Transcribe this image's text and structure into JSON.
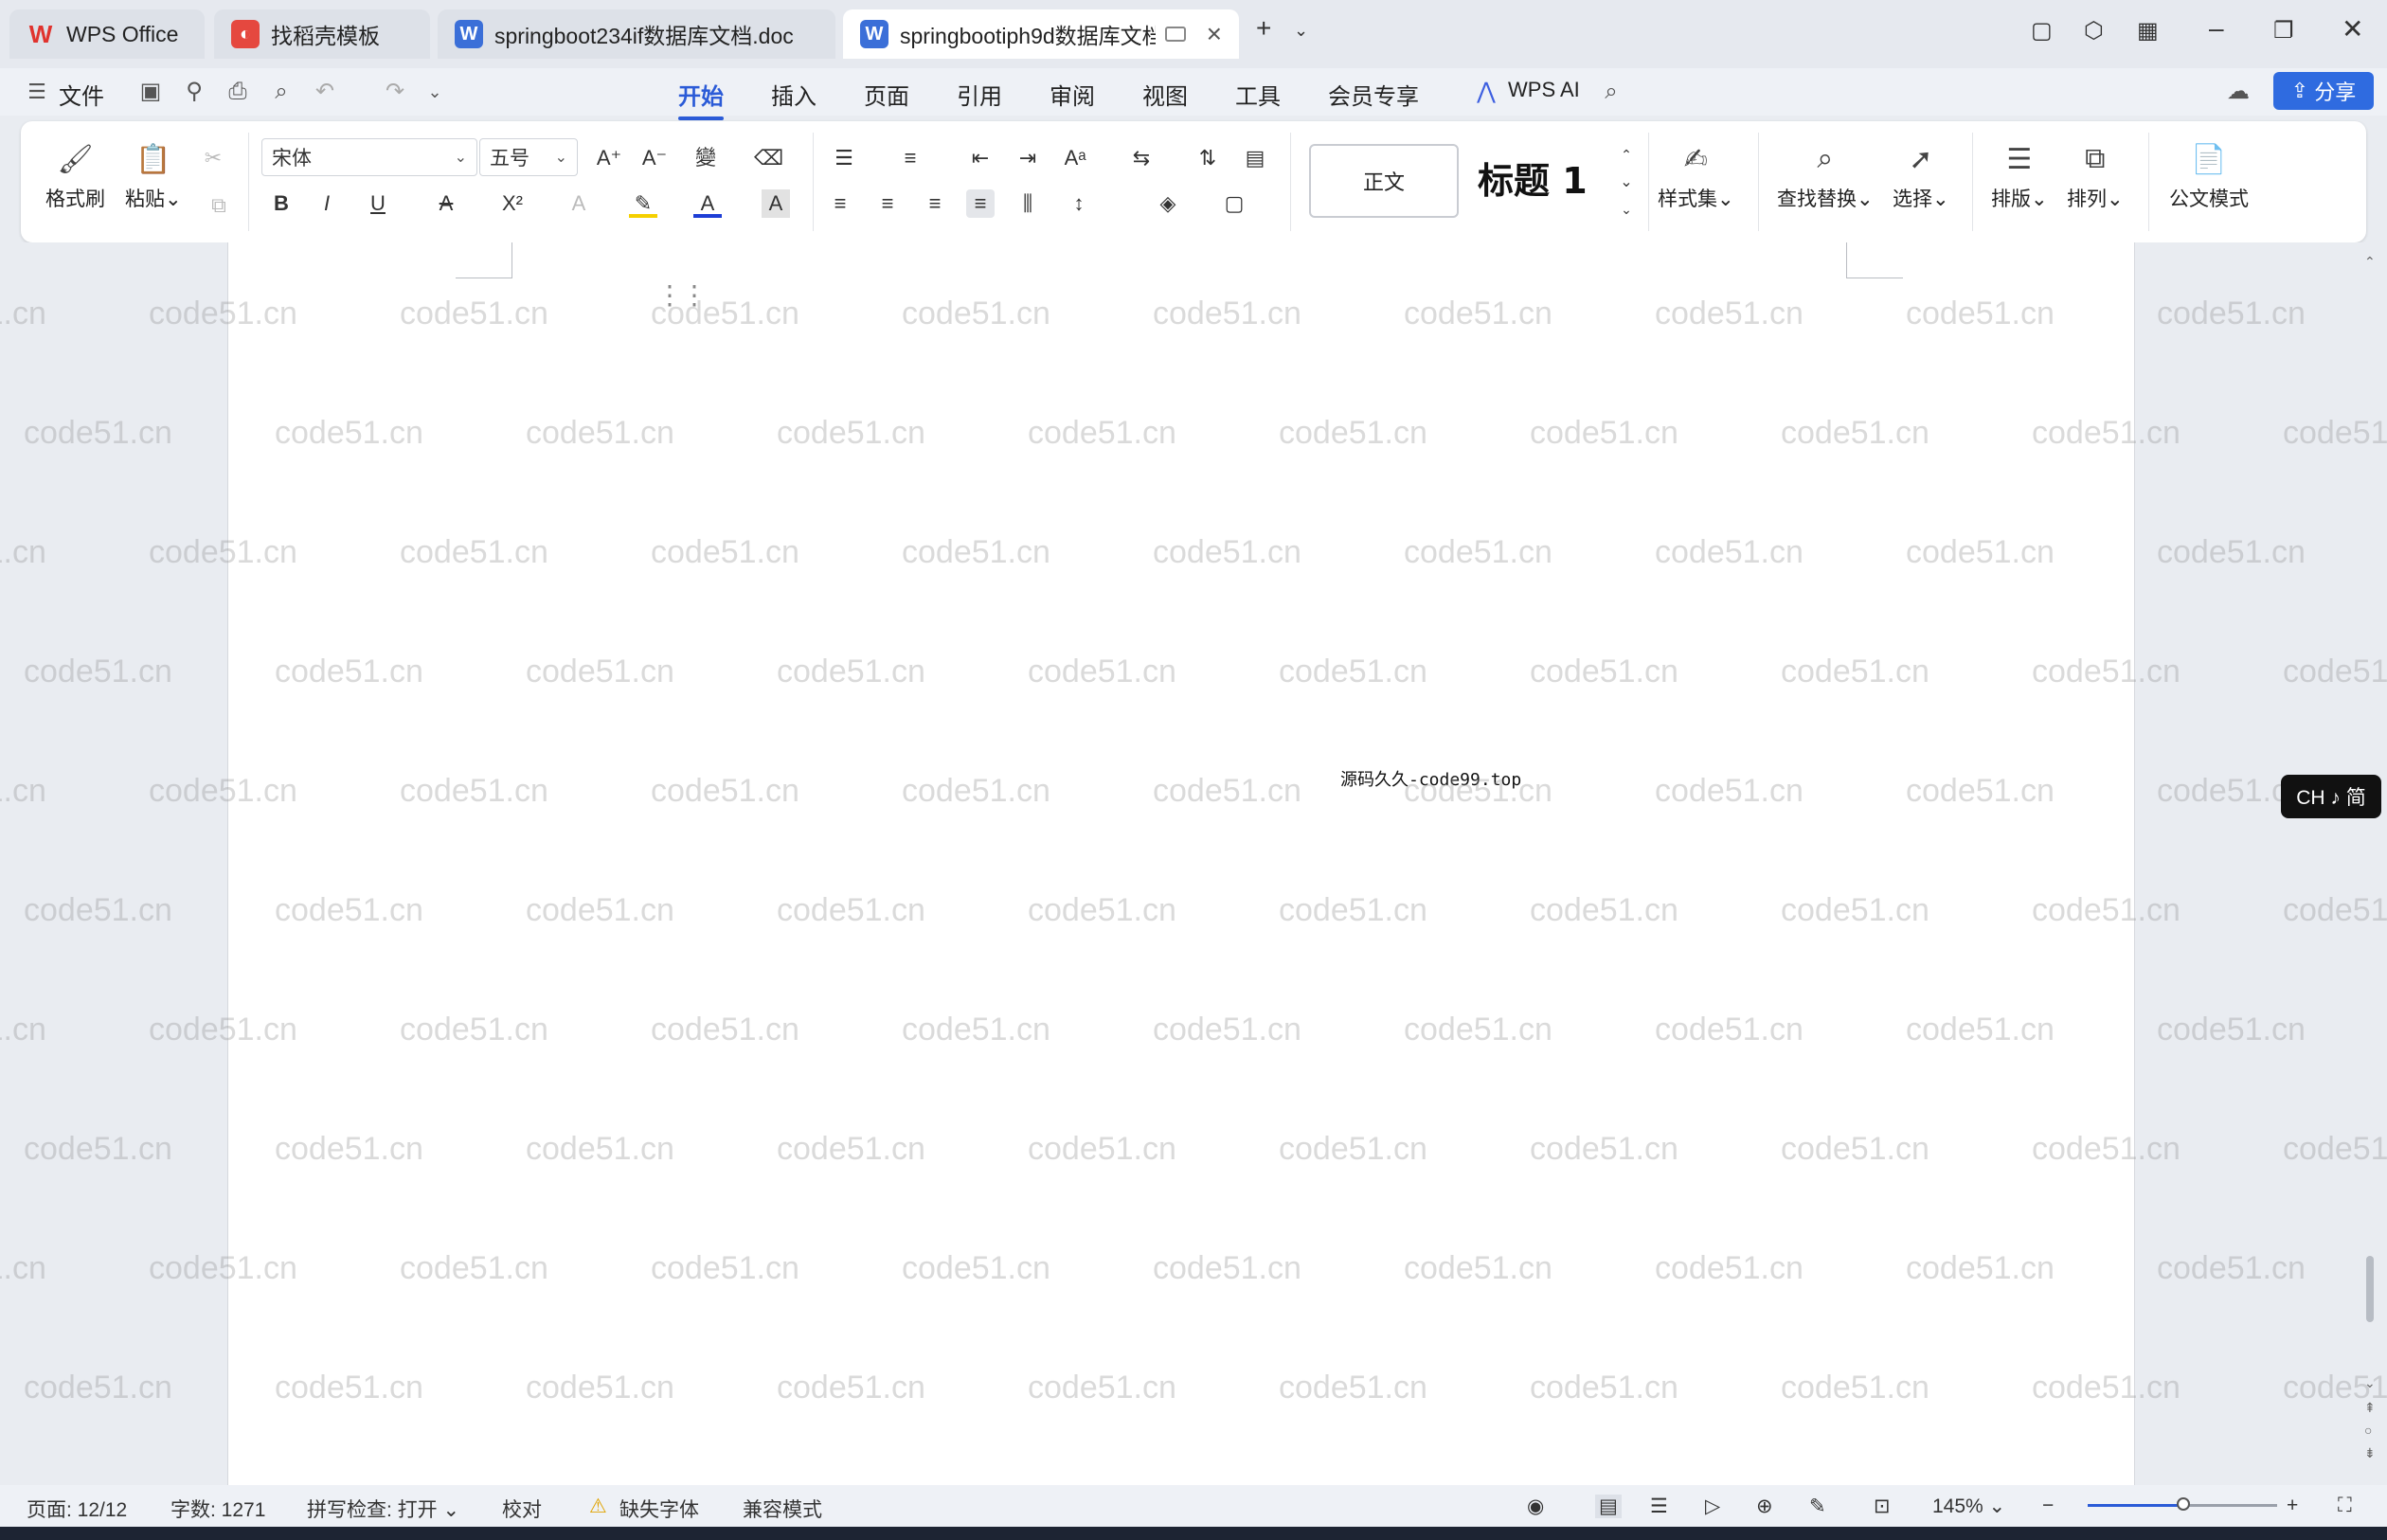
{
  "tabs": [
    {
      "label": "WPS Office",
      "icon": "wps-logo-icon"
    },
    {
      "label": "找稻壳模板",
      "icon": "docer-icon"
    },
    {
      "label": "springboot234if数据库文档.doc",
      "icon": "word-doc-icon"
    },
    {
      "label": "springbootiph9d数据库文档",
      "icon": "word-doc-icon"
    }
  ],
  "menu": {
    "file": "文件",
    "items": [
      "开始",
      "插入",
      "页面",
      "引用",
      "审阅",
      "视图",
      "工具",
      "会员专享"
    ],
    "active": "开始",
    "wps_ai": "WPS AI",
    "share": "分享"
  },
  "ribbon": {
    "format_painter": "格式刷",
    "paste": "粘贴",
    "font_name": "宋体",
    "font_size": "五号",
    "style_normal": "正文",
    "style_heading": "标题 1",
    "style_set": "样式集",
    "find_replace": "查找替换",
    "select": "选择",
    "typeset": "排版",
    "arrange": "排列",
    "official_mode": "公文模式"
  },
  "document": {
    "footer_text": "源码久久-code99.top",
    "watermark": "code51.cn"
  },
  "ime": {
    "label": "CH ♪ 简"
  },
  "status": {
    "page": "页面: 12/12",
    "word_count": "字数: 1271",
    "spell_check": "拼写检查: 打开",
    "proofread": "校对",
    "missing_font": "缺失字体",
    "compat_mode": "兼容模式",
    "zoom": "145%"
  },
  "colors": {
    "accent": "#2b5bd7",
    "share_button": "#2f6be0"
  }
}
